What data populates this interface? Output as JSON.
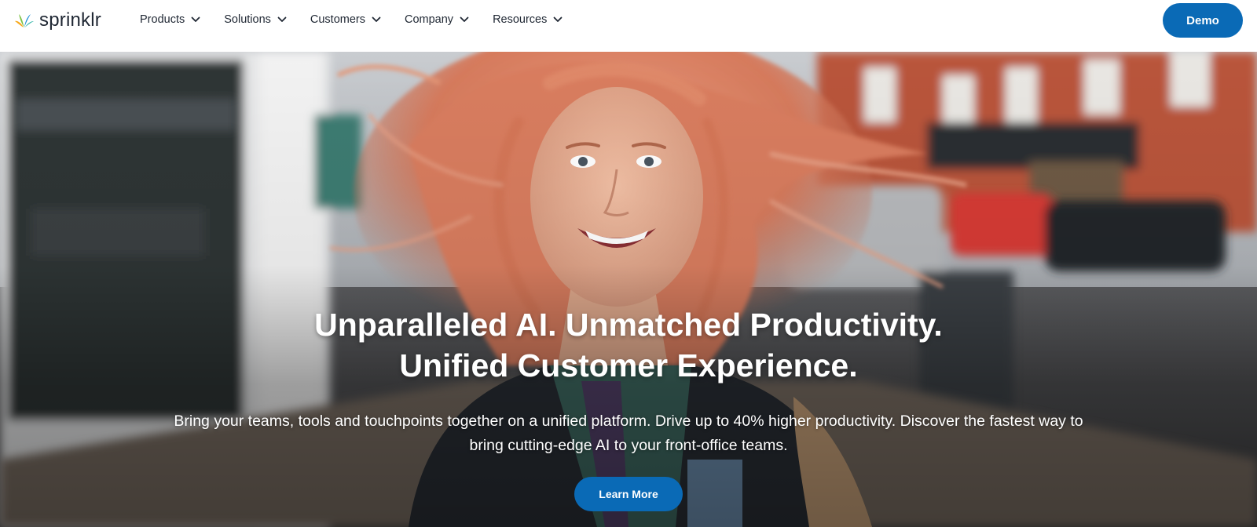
{
  "brand": {
    "name": "sprinklr",
    "logo_colors": [
      "#f7a81b",
      "#33b5a8",
      "#1f8fd6",
      "#7cc242"
    ]
  },
  "nav": {
    "items": [
      {
        "label": "Products"
      },
      {
        "label": "Solutions"
      },
      {
        "label": "Customers"
      },
      {
        "label": "Company"
      },
      {
        "label": "Resources"
      }
    ],
    "icon": "chevron-down-icon"
  },
  "header": {
    "demo_label": "Demo"
  },
  "hero": {
    "headline_line1": "Unparalleled AI. Unmatched Productivity.",
    "headline_line2": "Unified Customer Experience.",
    "subcopy": "Bring your teams, tools and touchpoints together on a unified platform. Drive up to 40% higher productivity. Discover the fastest way to bring cutting-edge AI to your front-office teams.",
    "cta_label": "Learn More"
  },
  "colors": {
    "accent": "#0a6ab6",
    "nav_text": "#1f2733",
    "hero_text": "#ffffff"
  }
}
